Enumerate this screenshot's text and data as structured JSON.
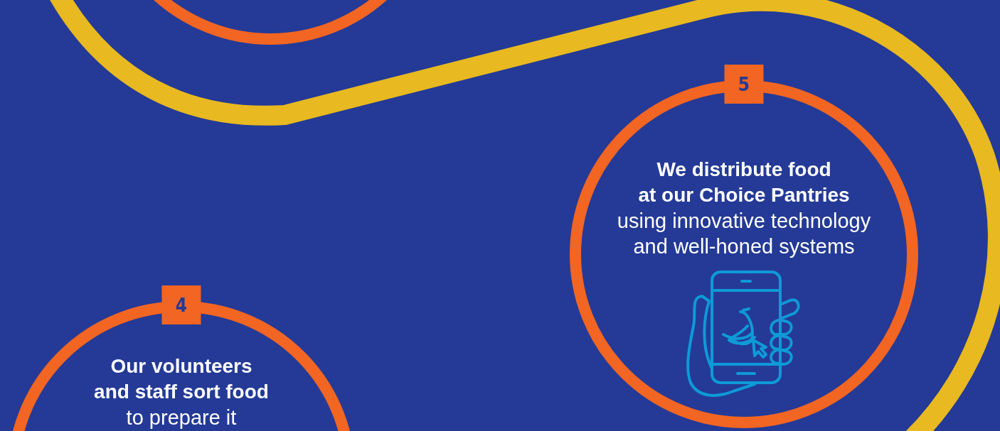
{
  "steps": [
    {
      "number": "4",
      "kind": "text",
      "heading": [
        "Our volunteers",
        "and staff sort food"
      ],
      "body": [
        "to prepare it"
      ]
    },
    {
      "number": "5",
      "kind": "illustrated",
      "heading": [
        "We distribute food",
        "at our Choice Pantries"
      ],
      "body": [
        "using innovative technology",
        "and well-honed systems"
      ]
    }
  ]
}
